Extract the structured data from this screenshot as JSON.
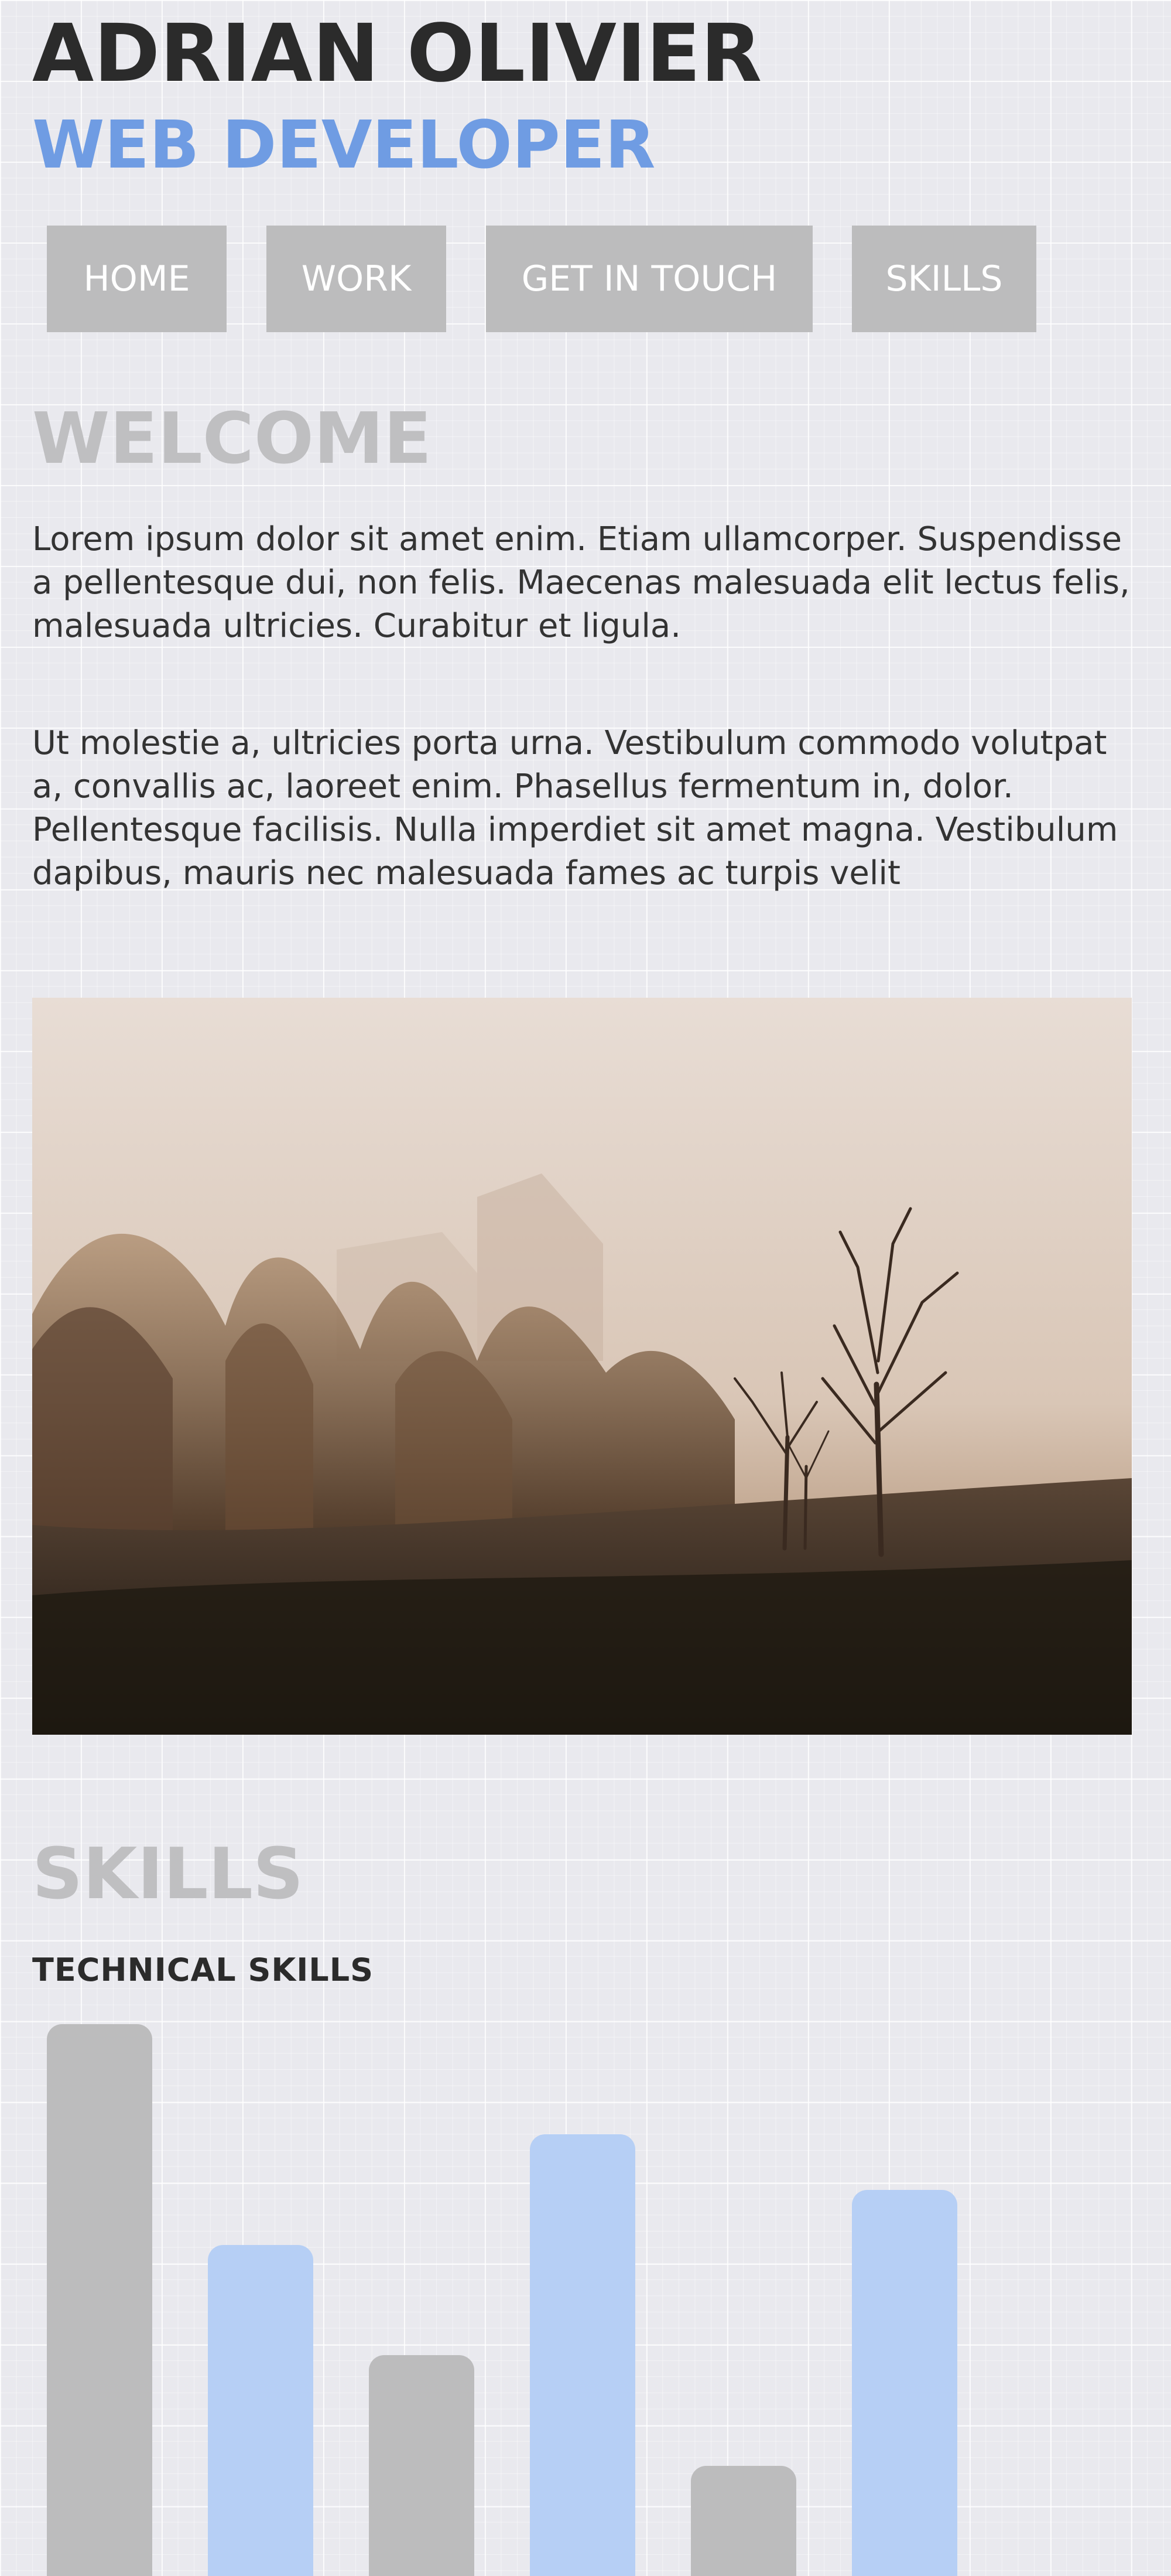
{
  "header": {
    "name": "ADRIAN OLIVIER",
    "role": "WEB DEVELOPER"
  },
  "nav": {
    "home": "HOME",
    "work": "WORK",
    "contact": "GET IN TOUCH",
    "skills": "SKILLS"
  },
  "welcome": {
    "title": "WELCOME",
    "paragraphs": [
      "Lorem ipsum dolor sit amet enim. Etiam ullamcorper. Suspendisse a pellentesque dui, non felis. Maecenas malesuada elit lectus felis, malesuada ultricies. Curabitur et ligula.",
      "Ut molestie a, ultricies porta urna. Vestibulum commodo volutpat a, convallis ac, laoreet enim. Phasellus fermentum in, dolor. Pellentesque facilisis. Nulla imperdiet sit amet magna. Vestibulum dapibus, mauris nec malesuada fames ac turpis velit"
    ]
  },
  "skills": {
    "title": "SKILLS",
    "subtitle": "TECHNICAL SKILLS",
    "bar_colors": [
      "#bcbcbd",
      "#b6cff5"
    ]
  },
  "chart_data": {
    "type": "bar",
    "categories": [
      "",
      "",
      "",
      "",
      "",
      ""
    ],
    "values": [
      100,
      60,
      40,
      80,
      20,
      70
    ],
    "ylim": [
      0,
      100
    ],
    "grid": false,
    "legend": "none"
  }
}
